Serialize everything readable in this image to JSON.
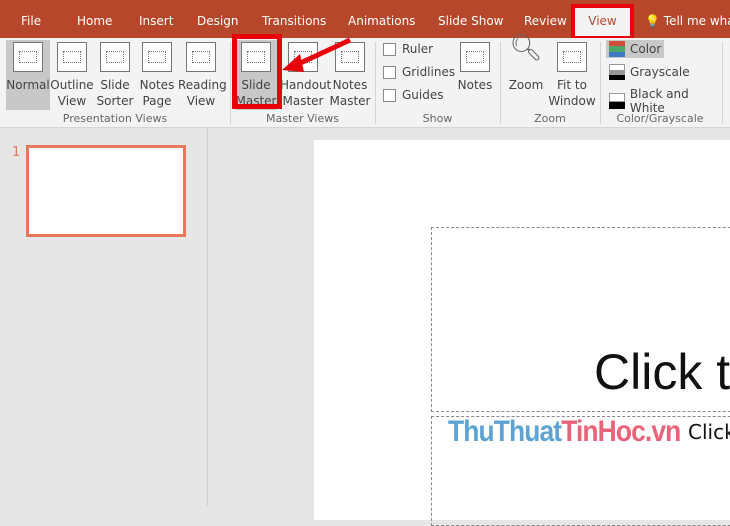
{
  "tabs": [
    "File",
    "Home",
    "Insert",
    "Design",
    "Transitions",
    "Animations",
    "Slide Show",
    "Review",
    "View"
  ],
  "tell_me": "Tell me what",
  "ribbon": {
    "presentation_views": {
      "label": "Presentation Views",
      "buttons": [
        {
          "l1": "Normal",
          "l2": ""
        },
        {
          "l1": "Outline",
          "l2": "View"
        },
        {
          "l1": "Slide",
          "l2": "Sorter"
        },
        {
          "l1": "Notes",
          "l2": "Page"
        },
        {
          "l1": "Reading",
          "l2": "View"
        }
      ]
    },
    "master_views": {
      "label": "Master Views",
      "buttons": [
        {
          "l1": "Slide",
          "l2": "Master"
        },
        {
          "l1": "Handout",
          "l2": "Master"
        },
        {
          "l1": "Notes",
          "l2": "Master"
        }
      ]
    },
    "show": {
      "label": "Show",
      "checkboxes": [
        "Ruler",
        "Gridlines",
        "Guides"
      ],
      "notes": "Notes"
    },
    "zoom": {
      "label": "Zoom",
      "zoom": "Zoom",
      "fit_l1": "Fit to",
      "fit_l2": "Window"
    },
    "color": {
      "label": "Color/Grayscale",
      "options": [
        "Color",
        "Grayscale",
        "Black and White"
      ]
    }
  },
  "slide_number": "1",
  "slide": {
    "title": "Click t",
    "subtitle": "Click"
  },
  "watermark": {
    "part1": "ThuThuat",
    "part2": "TinHoc",
    "part3": ".vn"
  },
  "colors": {
    "accent": "#b7472a",
    "highlight": "#e8000b"
  }
}
